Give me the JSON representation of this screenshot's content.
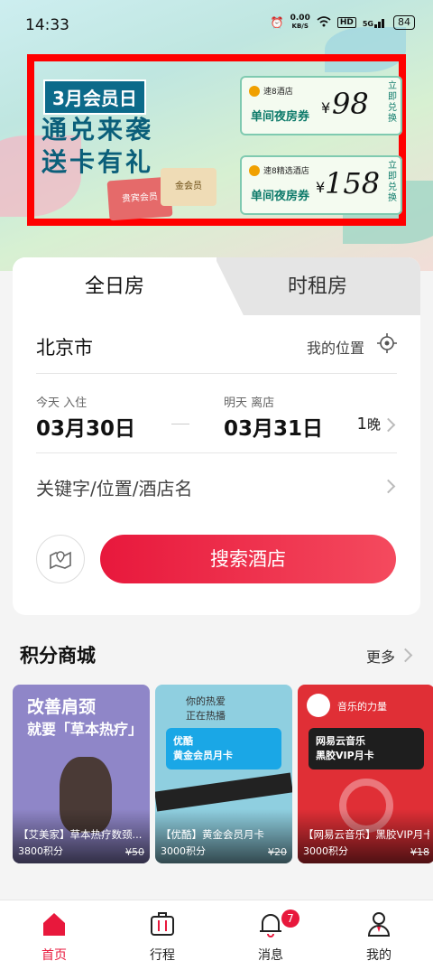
{
  "status_bar": {
    "time": "14:33",
    "net_speed": "0.00",
    "net_unit": "KB/S",
    "hd": "HD",
    "signal": "5G",
    "battery": "84"
  },
  "banner": {
    "tag": "3月会员日",
    "slogan_line1": "通兑来袭",
    "slogan_line2": "送卡有礼",
    "vip_card": "贵宾会员",
    "gold_card": "金会员",
    "coupons": [
      {
        "brand": "速8酒店",
        "name": "单间夜房券",
        "currency": "¥",
        "price": "98",
        "action": "立即兑换"
      },
      {
        "brand": "速8精选酒店",
        "name": "单间夜房券",
        "currency": "¥",
        "price": "158",
        "action": "立即兑换"
      }
    ]
  },
  "booking": {
    "tabs": [
      "全日房",
      "时租房"
    ],
    "city": "北京市",
    "my_location": "我的位置",
    "checkin_label": "今天 入住",
    "checkin_date": "03月30日",
    "checkout_label": "明天 离店",
    "checkout_date": "03月31日",
    "nights": "1",
    "nights_unit": "晚",
    "keyword_placeholder": "关键字/位置/酒店名",
    "search_button": "搜索酒店"
  },
  "mall": {
    "title": "积分商城",
    "more": "更多",
    "products": [
      {
        "name": "【艾美家】草本热疗数颈...",
        "points": "3800积分",
        "old_price": "¥50",
        "art_line1": "改善肩颈",
        "art_line2": "就要「草本热疗」",
        "color": "#8f86c8"
      },
      {
        "name": "【优酷】黄金会员月卡",
        "points": "3000积分",
        "old_price": "¥20",
        "art_line1": "你的热爱",
        "art_line2": "正在热播",
        "card": "优酷\n黄金会员月卡",
        "color": "#8fcfe0"
      },
      {
        "name": "【网易云音乐】黑胶VIP月卡",
        "points": "3000积分",
        "old_price": "¥18",
        "art_line1": "音乐的力量",
        "card": "网易云音乐\n黑胶VIP月卡",
        "color": "#e02f36"
      }
    ]
  },
  "tabbar": {
    "items": [
      {
        "label": "首页",
        "icon": "home-icon",
        "active": true
      },
      {
        "label": "行程",
        "icon": "luggage-icon",
        "active": false
      },
      {
        "label": "消息",
        "icon": "bell-icon",
        "active": false
      },
      {
        "label": "我的",
        "icon": "user-icon",
        "active": false
      }
    ],
    "message_badge": "7"
  },
  "colors": {
    "accent": "#e8183c",
    "banner_highlight": "#ff0000"
  }
}
